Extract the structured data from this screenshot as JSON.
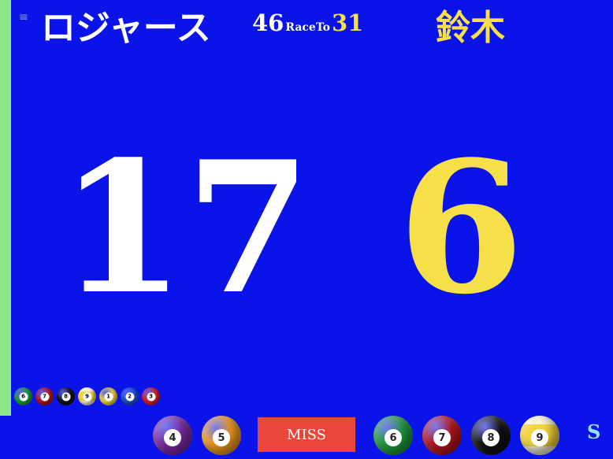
{
  "player1": {
    "name": "ロジャース",
    "score": "17",
    "race_to": "46"
  },
  "race_label": "RaceTo",
  "player2": {
    "name": "鈴木",
    "score": "6",
    "race_to": "31"
  },
  "menu_icon": "≡",
  "mini_balls": [
    {
      "number": "6",
      "color": "#1f9d3b"
    },
    {
      "number": "7",
      "color": "#b8141d"
    },
    {
      "number": "8",
      "color": "#111111"
    },
    {
      "number": "9",
      "color": "#f2d33a"
    },
    {
      "number": "1",
      "color": "#f2d33a"
    },
    {
      "number": "2",
      "color": "#1d4fd6"
    },
    {
      "number": "3",
      "color": "#d8202a"
    }
  ],
  "bottom_balls": {
    "b4": {
      "number": "4",
      "color": "#7b2aa5"
    },
    "b5": {
      "number": "5",
      "color": "#f39a1c"
    },
    "b6": {
      "number": "6",
      "color": "#1f9d3b"
    },
    "b7": {
      "number": "7",
      "color": "#b8141d"
    },
    "b8": {
      "number": "8",
      "color": "#111111"
    },
    "b9": {
      "number": "9",
      "color": "#f2d33a"
    }
  },
  "miss_label": "MISS",
  "s_label": "S",
  "colors": {
    "background": "#0a14e8",
    "player2_text": "#f5e04a",
    "left_strip": "#8ee68a",
    "miss_button": "#e8473a"
  }
}
